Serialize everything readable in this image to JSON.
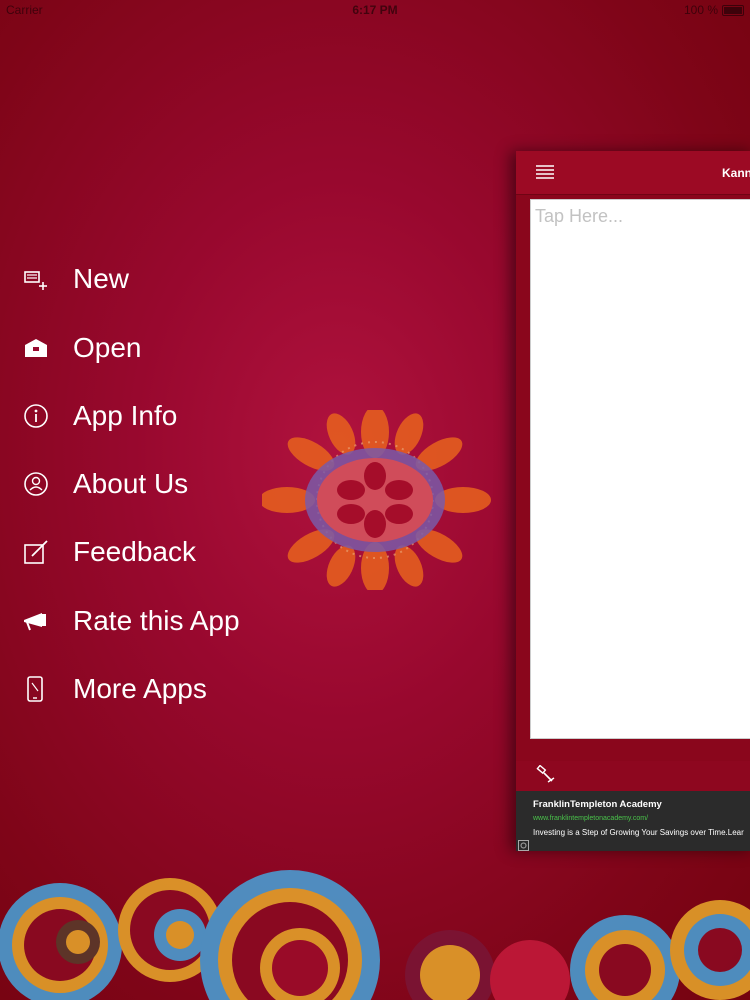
{
  "status_bar": {
    "carrier": "Carrier",
    "time": "6:17 PM",
    "battery": "100 %"
  },
  "menu": {
    "items": [
      {
        "label": "New",
        "icon": "new-note-icon"
      },
      {
        "label": "Open",
        "icon": "open-box-icon"
      },
      {
        "label": "App Info",
        "icon": "info-icon"
      },
      {
        "label": "About Us",
        "icon": "about-person-icon"
      },
      {
        "label": "Feedback",
        "icon": "edit-pencil-icon"
      },
      {
        "label": "Rate this App",
        "icon": "megaphone-icon"
      },
      {
        "label": "More Apps",
        "icon": "mobile-apps-icon"
      }
    ]
  },
  "panel": {
    "title": "Kann",
    "placeholder": "Tap Here...",
    "toolbar_icon": "clear-brush-icon"
  },
  "ad": {
    "title": "FranklinTempleton Academy",
    "url": "www.franklintempletonacademy.com/",
    "text": "Investing is a Step of Growing Your Savings over Time.Lear"
  },
  "colors": {
    "background": "#98082e",
    "panel_nav": "#9c0a24",
    "flower_orange": "#e8621e",
    "flower_center": "#7a5aa8",
    "ad_url_green": "#49c24a"
  }
}
